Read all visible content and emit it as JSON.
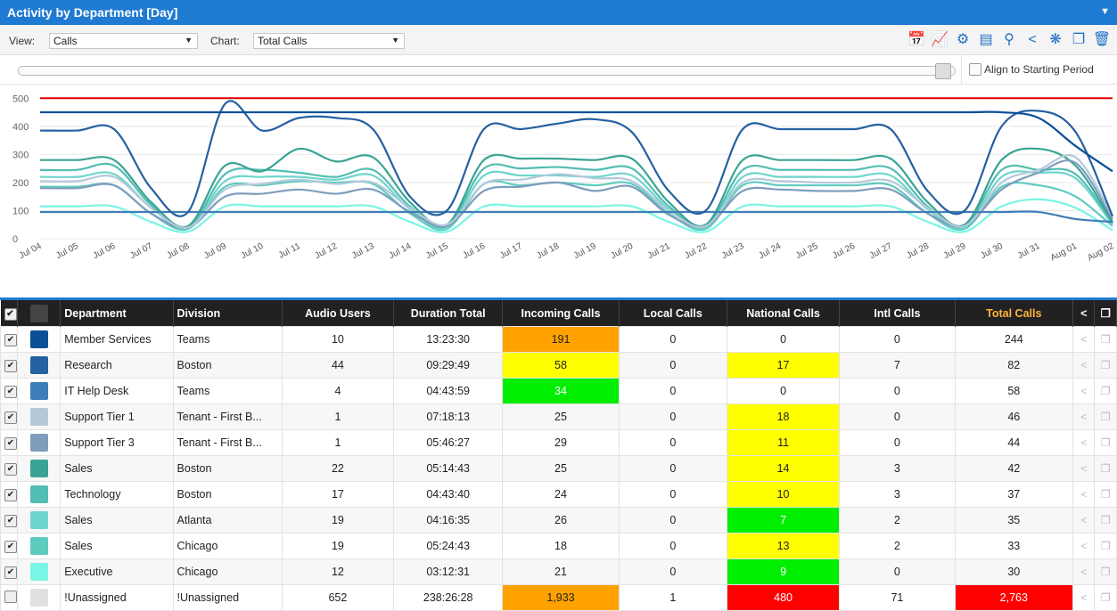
{
  "title": "Activity by Department [Day]",
  "toolbar": {
    "view_label": "View:",
    "view_value": "Calls",
    "chart_label": "Chart:",
    "chart_value": "Total Calls"
  },
  "align_label": "Align to Starting Period",
  "colors": {
    "accent": "#1f7ad1",
    "orange": "#ffa200",
    "yellow": "#ffff00",
    "green": "#00ee00",
    "red": "#ff0000",
    "limit_line": "#e00000"
  },
  "chart_data": {
    "type": "line",
    "x": [
      "Jul 04",
      "Jul 05",
      "Jul 06",
      "Jul 07",
      "Jul 08",
      "Jul 09",
      "Jul 10",
      "Jul 11",
      "Jul 12",
      "Jul 13",
      "Jul 14",
      "Jul 15",
      "Jul 16",
      "Jul 17",
      "Jul 18",
      "Jul 19",
      "Jul 20",
      "Jul 21",
      "Jul 22",
      "Jul 23",
      "Jul 24",
      "Jul 25",
      "Jul 26",
      "Jul 27",
      "Jul 28",
      "Jul 29",
      "Jul 30",
      "Jul 31",
      "Aug 01",
      "Aug 02"
    ],
    "y_ticks": [
      "0",
      "100",
      "200",
      "300",
      "400",
      "500"
    ],
    "ylim": [
      0,
      520
    ],
    "threshold": 500,
    "series": [
      {
        "color": "#0a4f97",
        "values": [
          450,
          450,
          450,
          450,
          450,
          450,
          450,
          450,
          450,
          450,
          450,
          450,
          450,
          450,
          450,
          450,
          450,
          450,
          450,
          450,
          450,
          450,
          450,
          450,
          450,
          450,
          450,
          430,
          330,
          240
        ]
      },
      {
        "color": "#2560a0",
        "values": [
          385,
          385,
          390,
          180,
          95,
          480,
          385,
          430,
          430,
          390,
          150,
          100,
          390,
          390,
          410,
          425,
          380,
          170,
          100,
          390,
          390,
          390,
          390,
          390,
          170,
          100,
          400,
          455,
          380,
          80
        ]
      },
      {
        "color": "#3e7eb8",
        "values": [
          95,
          95,
          95,
          95,
          95,
          95,
          95,
          95,
          95,
          95,
          95,
          95,
          95,
          95,
          95,
          95,
          95,
          95,
          95,
          95,
          95,
          95,
          95,
          95,
          95,
          95,
          95,
          95,
          70,
          60
        ]
      },
      {
        "color": "#b4c9da",
        "values": [
          205,
          205,
          220,
          110,
          40,
          175,
          195,
          210,
          195,
          200,
          110,
          50,
          195,
          210,
          230,
          215,
          205,
          100,
          45,
          200,
          205,
          200,
          200,
          205,
          110,
          45,
          200,
          245,
          290,
          80
        ]
      },
      {
        "color": "#7e9dbd",
        "values": [
          180,
          180,
          190,
          90,
          40,
          150,
          160,
          175,
          160,
          175,
          95,
          45,
          170,
          185,
          200,
          170,
          185,
          85,
          45,
          170,
          175,
          170,
          170,
          175,
          90,
          45,
          175,
          235,
          270,
          70
        ]
      },
      {
        "color": "#3aa394",
        "values": [
          280,
          280,
          280,
          130,
          45,
          260,
          240,
          320,
          275,
          290,
          130,
          50,
          280,
          285,
          285,
          280,
          285,
          130,
          50,
          280,
          280,
          280,
          280,
          285,
          130,
          50,
          280,
          320,
          260,
          60
        ]
      },
      {
        "color": "#52bdb2",
        "values": [
          245,
          245,
          260,
          120,
          40,
          230,
          245,
          235,
          220,
          245,
          115,
          45,
          250,
          250,
          255,
          245,
          250,
          115,
          45,
          245,
          245,
          245,
          245,
          250,
          115,
          45,
          245,
          245,
          230,
          55
        ]
      },
      {
        "color": "#6dd6cc",
        "values": [
          220,
          220,
          230,
          110,
          40,
          205,
          220,
          220,
          210,
          225,
          105,
          40,
          225,
          225,
          225,
          220,
          225,
          105,
          40,
          220,
          220,
          220,
          220,
          225,
          105,
          40,
          220,
          235,
          215,
          50
        ]
      },
      {
        "color": "#5ecbbf",
        "values": [
          185,
          185,
          190,
          90,
          35,
          185,
          190,
          205,
          200,
          195,
          90,
          35,
          195,
          190,
          200,
          190,
          195,
          90,
          35,
          190,
          190,
          190,
          190,
          190,
          90,
          35,
          185,
          190,
          150,
          45
        ]
      },
      {
        "color": "#7af4e4",
        "values": [
          115,
          115,
          115,
          60,
          25,
          115,
          115,
          115,
          115,
          115,
          60,
          25,
          115,
          115,
          115,
          115,
          115,
          60,
          25,
          115,
          115,
          115,
          115,
          115,
          60,
          25,
          115,
          140,
          110,
          30
        ]
      }
    ]
  },
  "table": {
    "headers": {
      "department": "Department",
      "division": "Division",
      "audio_users": "Audio Users",
      "duration_total": "Duration Total",
      "incoming": "Incoming Calls",
      "local": "Local Calls",
      "national": "National Calls",
      "intl": "Intl Calls",
      "total": "Total Calls"
    },
    "rows": [
      {
        "checked": true,
        "color": "#0a4f97",
        "department": "Member Services",
        "division": "Teams",
        "audio_users": "10",
        "duration": "13:23:30",
        "incoming": "191",
        "incoming_bg": "orange",
        "local": "0",
        "national": "0",
        "national_bg": "",
        "intl": "0",
        "total": "244",
        "total_bg": ""
      },
      {
        "checked": true,
        "color": "#2560a0",
        "department": "Research",
        "division": "Boston",
        "audio_users": "44",
        "duration": "09:29:49",
        "incoming": "58",
        "incoming_bg": "yellow",
        "local": "0",
        "national": "17",
        "national_bg": "yellow",
        "intl": "7",
        "total": "82",
        "total_bg": ""
      },
      {
        "checked": true,
        "color": "#3e7eb8",
        "department": "IT Help Desk",
        "division": "Teams",
        "audio_users": "4",
        "duration": "04:43:59",
        "incoming": "34",
        "incoming_bg": "green",
        "local": "0",
        "national": "0",
        "national_bg": "",
        "intl": "0",
        "total": "58",
        "total_bg": ""
      },
      {
        "checked": true,
        "color": "#b4c9da",
        "department": "Support Tier 1",
        "division": "Tenant - First B...",
        "audio_users": "1",
        "duration": "07:18:13",
        "incoming": "25",
        "incoming_bg": "",
        "local": "0",
        "national": "18",
        "national_bg": "yellow",
        "intl": "0",
        "total": "46",
        "total_bg": ""
      },
      {
        "checked": true,
        "color": "#7e9dbd",
        "department": "Support Tier 3",
        "division": "Tenant - First B...",
        "audio_users": "1",
        "duration": "05:46:27",
        "incoming": "29",
        "incoming_bg": "",
        "local": "0",
        "national": "11",
        "national_bg": "yellow",
        "intl": "0",
        "total": "44",
        "total_bg": ""
      },
      {
        "checked": true,
        "color": "#3aa394",
        "department": "Sales",
        "division": "Boston",
        "audio_users": "22",
        "duration": "05:14:43",
        "incoming": "25",
        "incoming_bg": "",
        "local": "0",
        "national": "14",
        "national_bg": "yellow",
        "intl": "3",
        "total": "42",
        "total_bg": ""
      },
      {
        "checked": true,
        "color": "#52bdb2",
        "department": "Technology",
        "division": "Boston",
        "audio_users": "17",
        "duration": "04:43:40",
        "incoming": "24",
        "incoming_bg": "",
        "local": "0",
        "national": "10",
        "national_bg": "yellow",
        "intl": "3",
        "total": "37",
        "total_bg": ""
      },
      {
        "checked": true,
        "color": "#6dd6cc",
        "department": "Sales",
        "division": "Atlanta",
        "audio_users": "19",
        "duration": "04:16:35",
        "incoming": "26",
        "incoming_bg": "",
        "local": "0",
        "national": "7",
        "national_bg": "green",
        "intl": "2",
        "total": "35",
        "total_bg": ""
      },
      {
        "checked": true,
        "color": "#5ecbbf",
        "department": "Sales",
        "division": "Chicago",
        "audio_users": "19",
        "duration": "05:24:43",
        "incoming": "18",
        "incoming_bg": "",
        "local": "0",
        "national": "13",
        "national_bg": "yellow",
        "intl": "2",
        "total": "33",
        "total_bg": ""
      },
      {
        "checked": true,
        "color": "#7af4e4",
        "department": "Executive",
        "division": "Chicago",
        "audio_users": "12",
        "duration": "03:12:31",
        "incoming": "21",
        "incoming_bg": "",
        "local": "0",
        "national": "9",
        "national_bg": "green",
        "intl": "0",
        "total": "30",
        "total_bg": ""
      },
      {
        "checked": false,
        "color": "#e0e0e0",
        "department": "!Unassigned",
        "division": "!Unassigned",
        "audio_users": "652",
        "duration": "238:26:28",
        "incoming": "1,933",
        "incoming_bg": "orange",
        "local": "1",
        "national": "480",
        "national_bg": "red",
        "intl": "71",
        "total": "2,763",
        "total_bg": "red"
      }
    ]
  }
}
